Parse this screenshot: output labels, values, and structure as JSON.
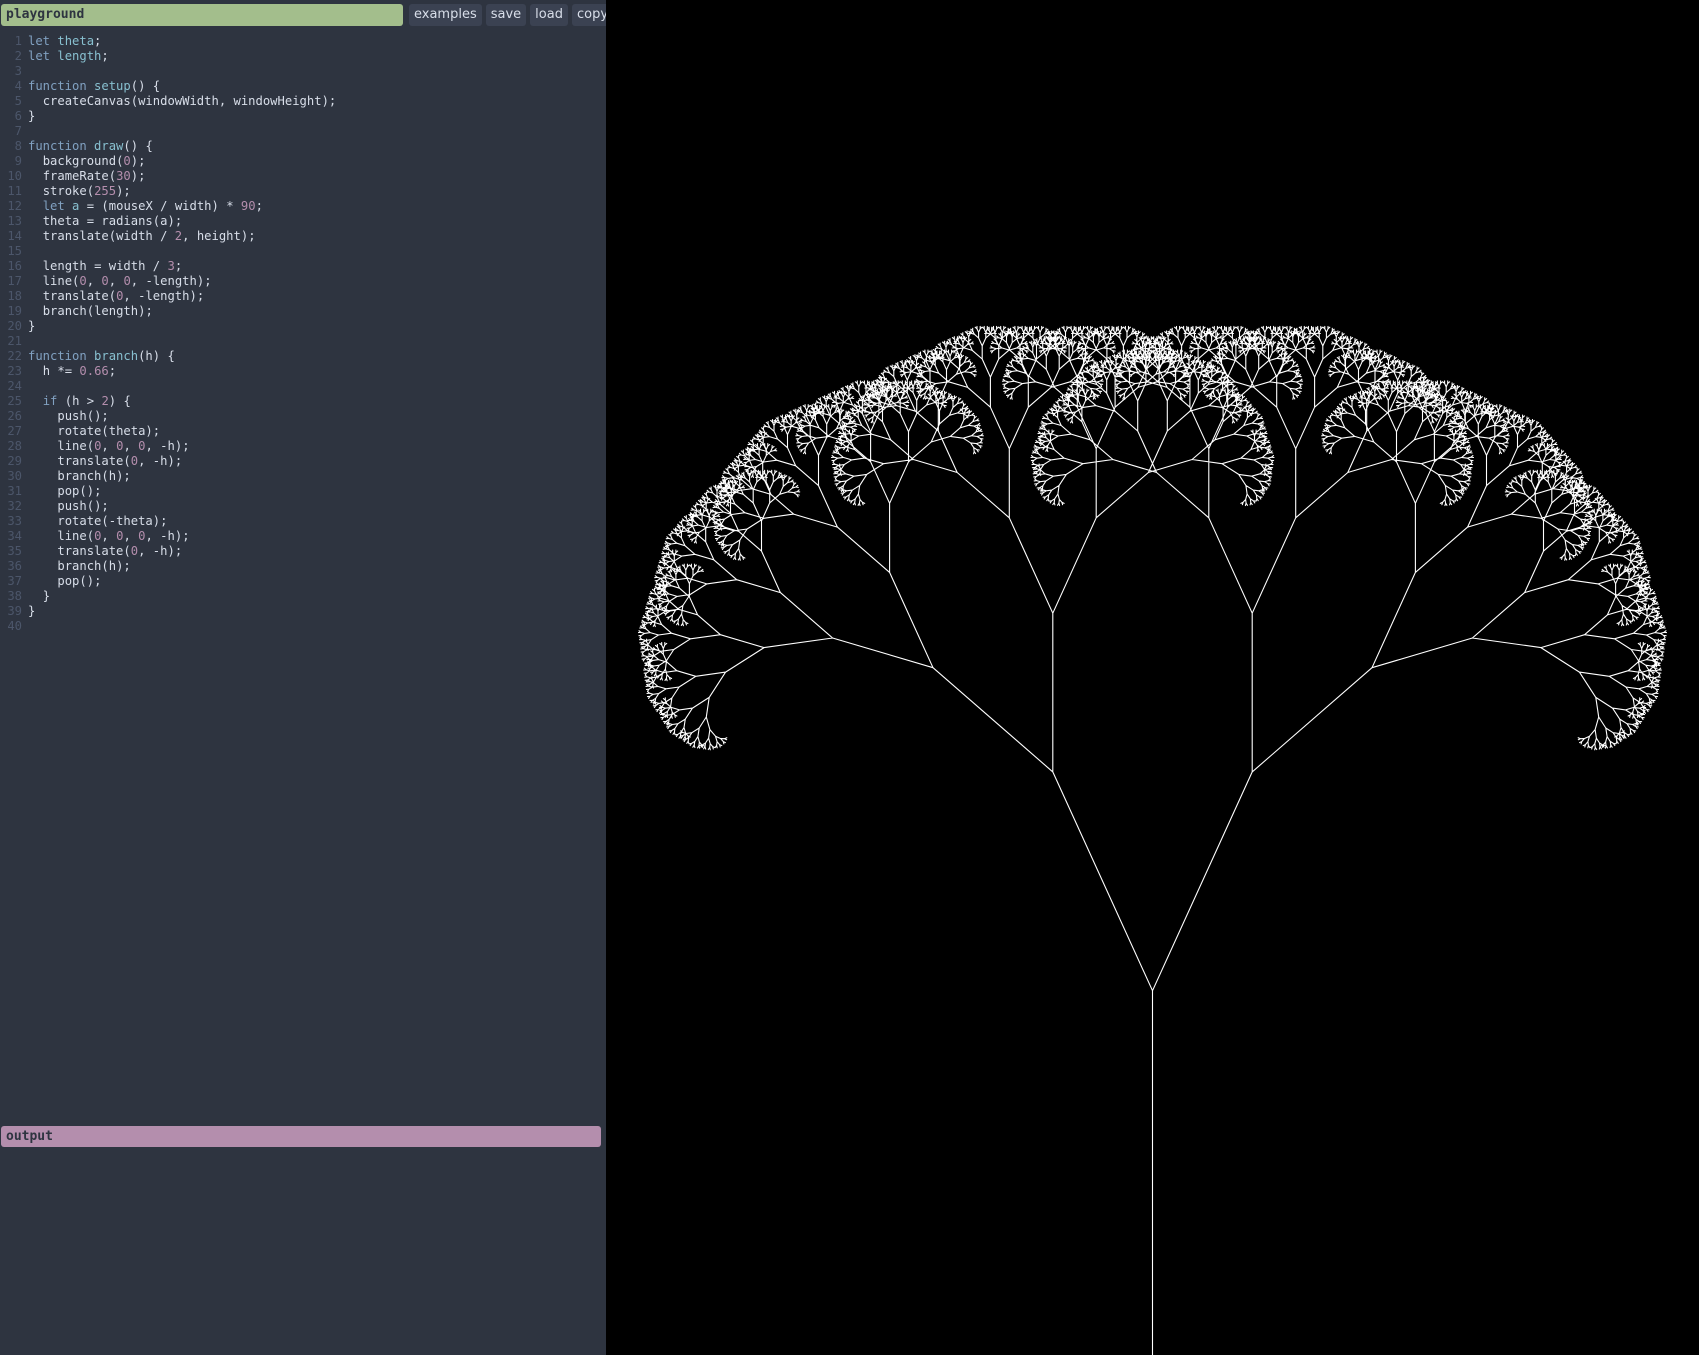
{
  "header": {
    "title": "playground"
  },
  "toolbar": {
    "buttons": [
      "examples",
      "save",
      "load",
      "copy"
    ]
  },
  "editor": {
    "lines": [
      "let theta;",
      "let length;",
      "",
      "function setup() {",
      "  createCanvas(windowWidth, windowHeight);",
      "}",
      "",
      "function draw() {",
      "  background(0);",
      "  frameRate(30);",
      "  stroke(255);",
      "  let a = (mouseX / width) * 90;",
      "  theta = radians(a);",
      "  translate(width / 2, height);",
      "",
      "  length = width / 3;",
      "  line(0, 0, 0, -length);",
      "  translate(0, -length);",
      "  branch(length);",
      "}",
      "",
      "function branch(h) {",
      "  h *= 0.66;",
      "",
      "  if (h > 2) {",
      "    push();",
      "    rotate(theta);",
      "    line(0, 0, 0, -h);",
      "    translate(0, -h);",
      "    branch(h);",
      "    pop();",
      "    push();",
      "    rotate(-theta);",
      "    line(0, 0, 0, -h);",
      "    translate(0, -h);",
      "    branch(h);",
      "    pop();",
      "  }",
      "}",
      ""
    ]
  },
  "output": {
    "title": "output"
  },
  "canvas": {
    "background": "#000000",
    "stroke": "#ffffff",
    "branch_angle_deg": 24.5,
    "shrink_factor": 0.66,
    "min_length": 2
  },
  "colors": {
    "editor_bg": "#2e3440",
    "title_bar": "#a3be8c",
    "output_bar": "#b48ead",
    "button_bg": "#3b4252"
  }
}
